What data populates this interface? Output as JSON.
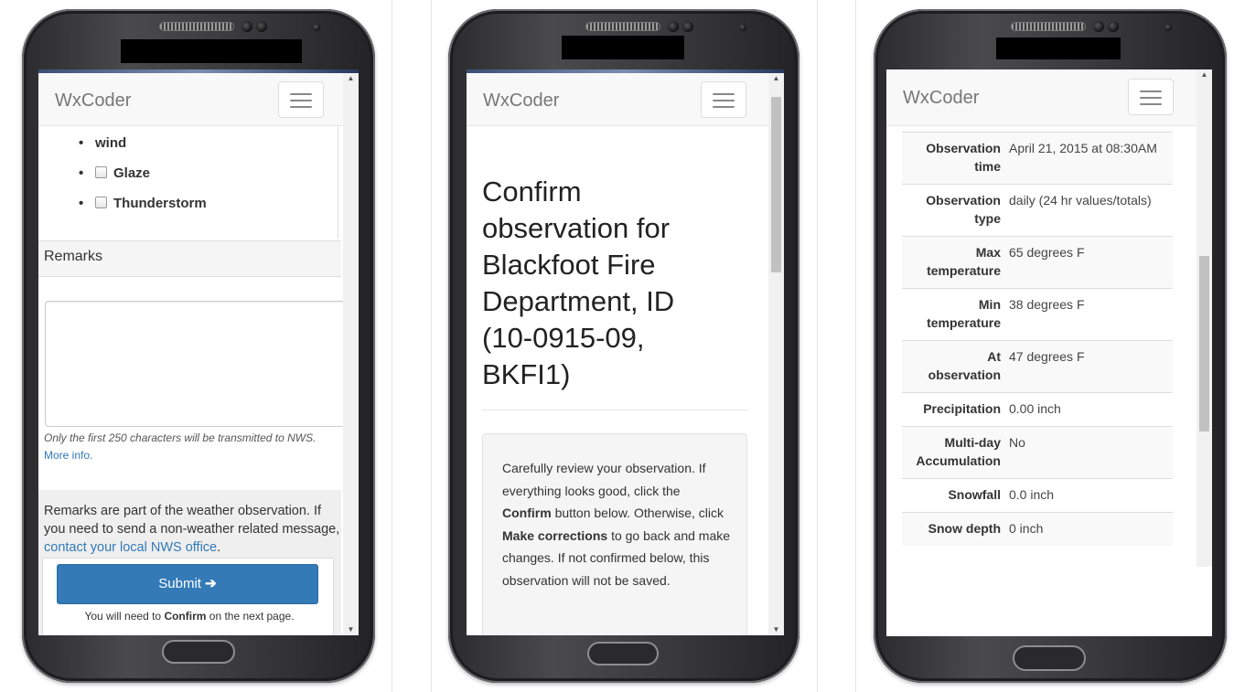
{
  "app": {
    "brand": "WxCoder"
  },
  "screen1": {
    "list_items": [
      "wind",
      "Glaze",
      "Thunderstorm"
    ],
    "remarks_heading": "Remarks",
    "remarks_value": "",
    "help_text": "Only the first 250 characters will be transmitted to NWS.",
    "more_info_link": "More info.",
    "notice_text": "Remarks are part of the weather observation. If you need to send a non-weather related message,",
    "notice_link": "contact your local NWS office",
    "notice_end": ".",
    "submit_label": "Submit",
    "submit_icon": "arrow-right-icon",
    "confirm_note_before": "You will need to",
    "confirm_note_bold": "Confirm",
    "confirm_note_after": "on the next page."
  },
  "screen2": {
    "title": "Confirm observation for Blackfoot Fire Department, ID (10-0915-09, BKFI1)",
    "instr_1": "Carefully review your observation. If everything looks good, click the",
    "instr_confirm": "Confirm",
    "instr_2": "button below. Otherwise, click",
    "instr_make": "Make corrections",
    "instr_3": "to go back and make changes. If not confirmed below, this observation will not be saved."
  },
  "screen3": {
    "rows": [
      {
        "k1": "Observation",
        "k2": "time",
        "v": "April 21, 2015 at 08:30AM"
      },
      {
        "k1": "Observation",
        "k2": "type",
        "v": "daily (24 hr values/totals)"
      },
      {
        "k1": "Max",
        "k2": "temperature",
        "v": "65 degrees F"
      },
      {
        "k1": "Min",
        "k2": "temperature",
        "v": "38 degrees F"
      },
      {
        "k1": "At",
        "k2": "observation",
        "v": "47 degrees F"
      },
      {
        "k1": "Precipitation",
        "k2": "",
        "v": "0.00 inch"
      },
      {
        "k1": "Multi-day",
        "k2": "Accumulation",
        "v": "No"
      },
      {
        "k1": "Snowfall",
        "k2": "",
        "v": "0.0 inch"
      },
      {
        "k1": "Snow depth",
        "k2": "",
        "v": "0 inch"
      }
    ]
  },
  "colors": {
    "primary": "#337ab7",
    "link": "#337ab7",
    "navbar_bg": "#f8f8f8"
  }
}
